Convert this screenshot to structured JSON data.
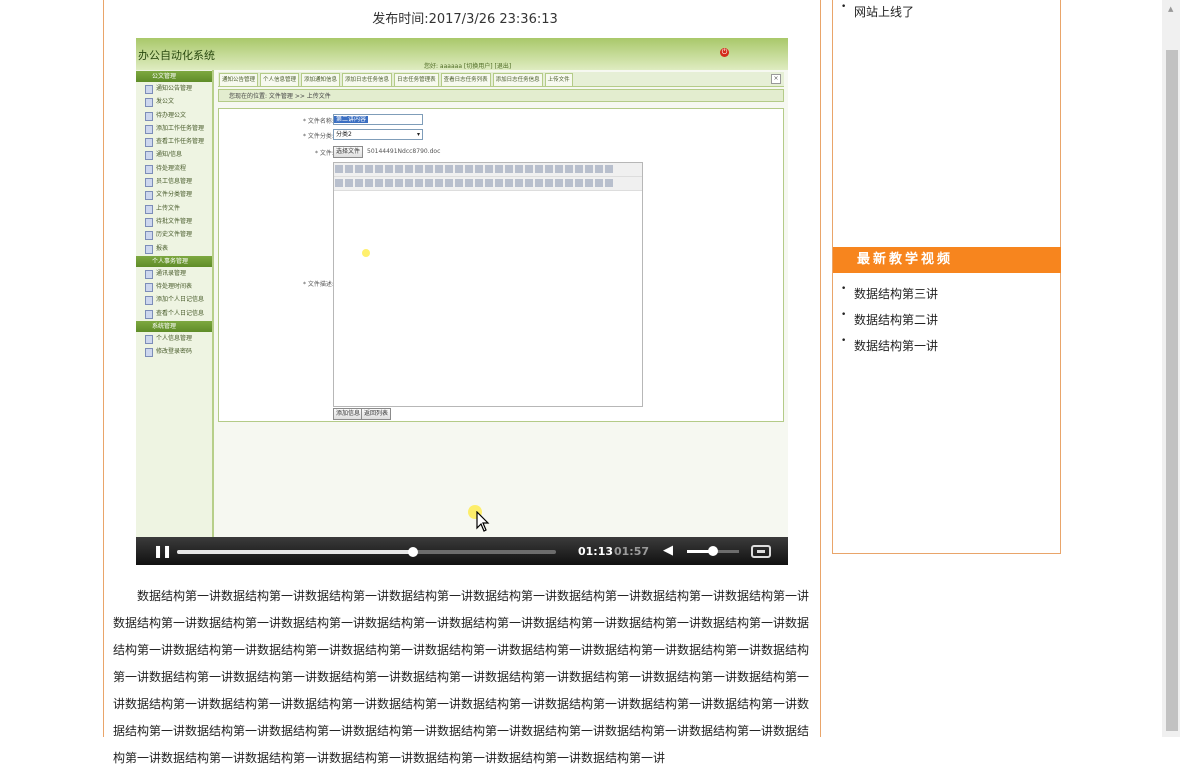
{
  "page": {
    "publish_time": "发布时间:2017/3/26 23:36:13",
    "article_text": "数据结构第一讲数据结构第一讲数据结构第一讲数据结构第一讲数据结构第一讲数据结构第一讲数据结构第一讲数据结构第一讲数据结构第一讲数据结构第一讲数据结构第一讲数据结构第一讲数据结构第一讲数据结构第一讲数据结构第一讲数据结构第一讲数据结构第一讲数据结构第一讲数据结构第一讲数据结构第一讲数据结构第一讲数据结构第一讲数据结构第一讲数据结构第一讲数据结构第一讲数据结构第一讲数据结构第一讲数据结构第一讲数据结构第一讲数据结构第一讲数据结构第一讲数据结构第一讲数据结构第一讲数据结构第一讲数据结构第一讲数据结构第一讲数据结构第一讲数据结构第一讲数据结构第一讲数据结构第一讲数据结构第一讲数据结构第一讲数据结构第一讲数据结构第一讲数据结构第一讲数据结构第一讲数据结构第一讲数据结构第一讲数据结构第一讲数据结构第一讲数据结构第一讲数据结构第一讲数据结构第一讲数据结构第一讲数据结构第一讲数据结构第一讲"
  },
  "video": {
    "oa": {
      "title": "办公自动化系统",
      "user_line": "您好: aaaaaa  [切换用户]  [退出]",
      "groups": [
        {
          "label": "公文管理",
          "items": [
            "通知公告管理",
            "发公文",
            "待办理公文",
            "添加工作任务管理",
            "查看工作任务管理",
            "通知/信息",
            "待处理流程",
            "员工信息管理",
            "文件分类管理",
            "上传文件",
            "待批文件管理",
            "历史文件管理",
            "报表"
          ]
        },
        {
          "label": "个人事务管理",
          "items": [
            "通讯录管理",
            "待处理时间表",
            "添加个人日记信息",
            "查看个人日记信息"
          ]
        },
        {
          "label": "系统管理",
          "items": [
            "个人信息管理",
            "修改登录密码"
          ]
        }
      ],
      "tabs": [
        "通知公告管理",
        "个人信息管理",
        "添加通知信息",
        "添加日志任务信息",
        "日志任务管理表",
        "查看日志任务列表",
        "添加日志任务信息",
        "上传文件"
      ],
      "breadcrumb": "您现在的位置: 文件管理 >> 上传文件",
      "form": {
        "name_label": "* 文件名称:",
        "name_value": "第二讲内容",
        "type_label": "* 文件分类:",
        "type_value": "分类2",
        "file_label": "* 文件:",
        "choose_btn": "选择文件",
        "file_value": "50144491Ndcc8790.doc",
        "content_label": "* 文件描述:",
        "submit_btn": "添加信息",
        "back_btn": "返回列表"
      }
    },
    "player": {
      "current_time": "01:13",
      "total_time": "01:57",
      "progress": 0.624,
      "volume": 0.5
    }
  },
  "sidebar": {
    "top_items": [
      "网站上线了"
    ],
    "video_section_title": "最新教学视频",
    "video_items": [
      "数据结构第三讲",
      "数据结构第二讲",
      "数据结构第一讲"
    ]
  }
}
